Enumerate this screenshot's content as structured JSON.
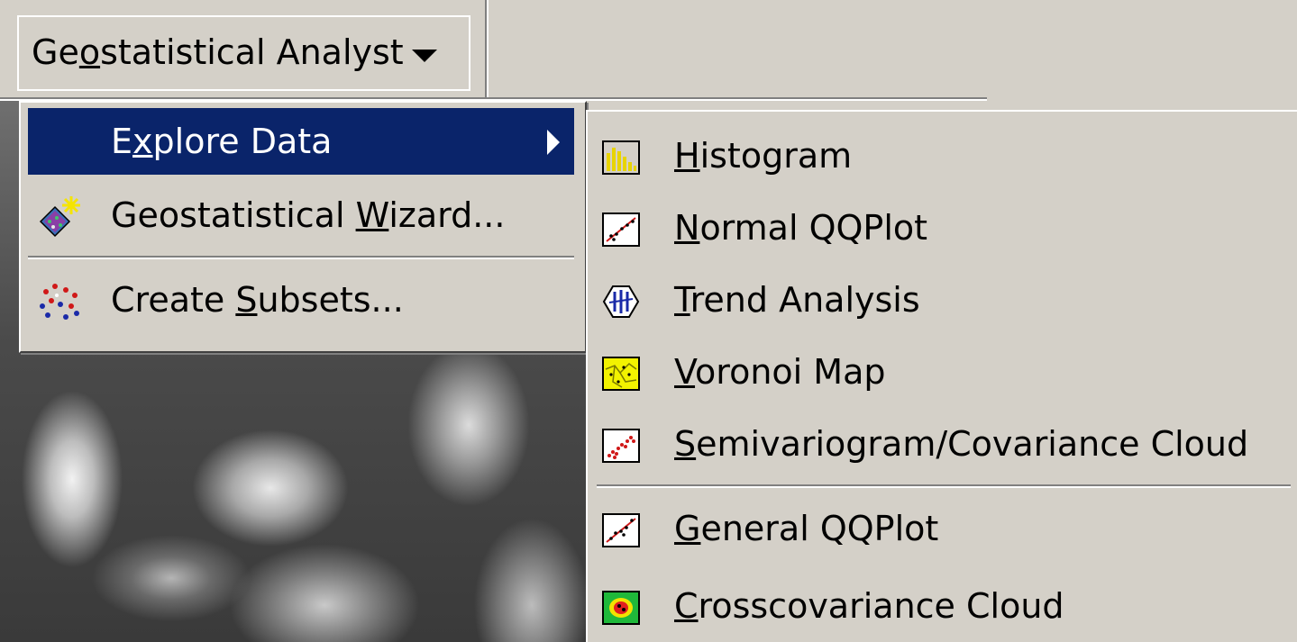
{
  "toolbar": {
    "dropdown_label": "Geostatistical Analyst",
    "dropdown_label_pre": "Ge",
    "dropdown_label_u": "o",
    "dropdown_label_post": "statistical Analyst"
  },
  "main_menu": {
    "items": [
      {
        "pre": "E",
        "u": "x",
        "post": "plore Data",
        "icon": "none",
        "highlighted": true,
        "has_submenu": true
      },
      {
        "pre": "Geostatistical ",
        "u": "W",
        "post": "izard...",
        "icon": "wizard-icon"
      },
      {
        "pre": "Create ",
        "u": "S",
        "post": "ubsets...",
        "icon": "subsets-icon"
      }
    ]
  },
  "submenu": {
    "items": [
      {
        "u": "H",
        "post": "istogram",
        "icon": "histogram-icon"
      },
      {
        "u": "N",
        "post": "ormal QQPlot",
        "icon": "qqplot-icon"
      },
      {
        "u": "T",
        "post": "rend Analysis",
        "icon": "trend-analysis-icon"
      },
      {
        "u": "V",
        "post": "oronoi Map",
        "icon": "voronoi-map-icon"
      },
      {
        "u": "S",
        "post": "emivariogram/Covariance Cloud",
        "icon": "semivariogram-icon"
      },
      {
        "u": "G",
        "post": "eneral QQPlot",
        "icon": "general-qqplot-icon"
      },
      {
        "u": "C",
        "post": "rosscovariance Cloud",
        "icon": "crosscovariance-icon"
      }
    ]
  },
  "colors": {
    "menu_bg": "#d4d0c8",
    "highlight": "#0a246a",
    "highlight_text": "#ffffff"
  }
}
